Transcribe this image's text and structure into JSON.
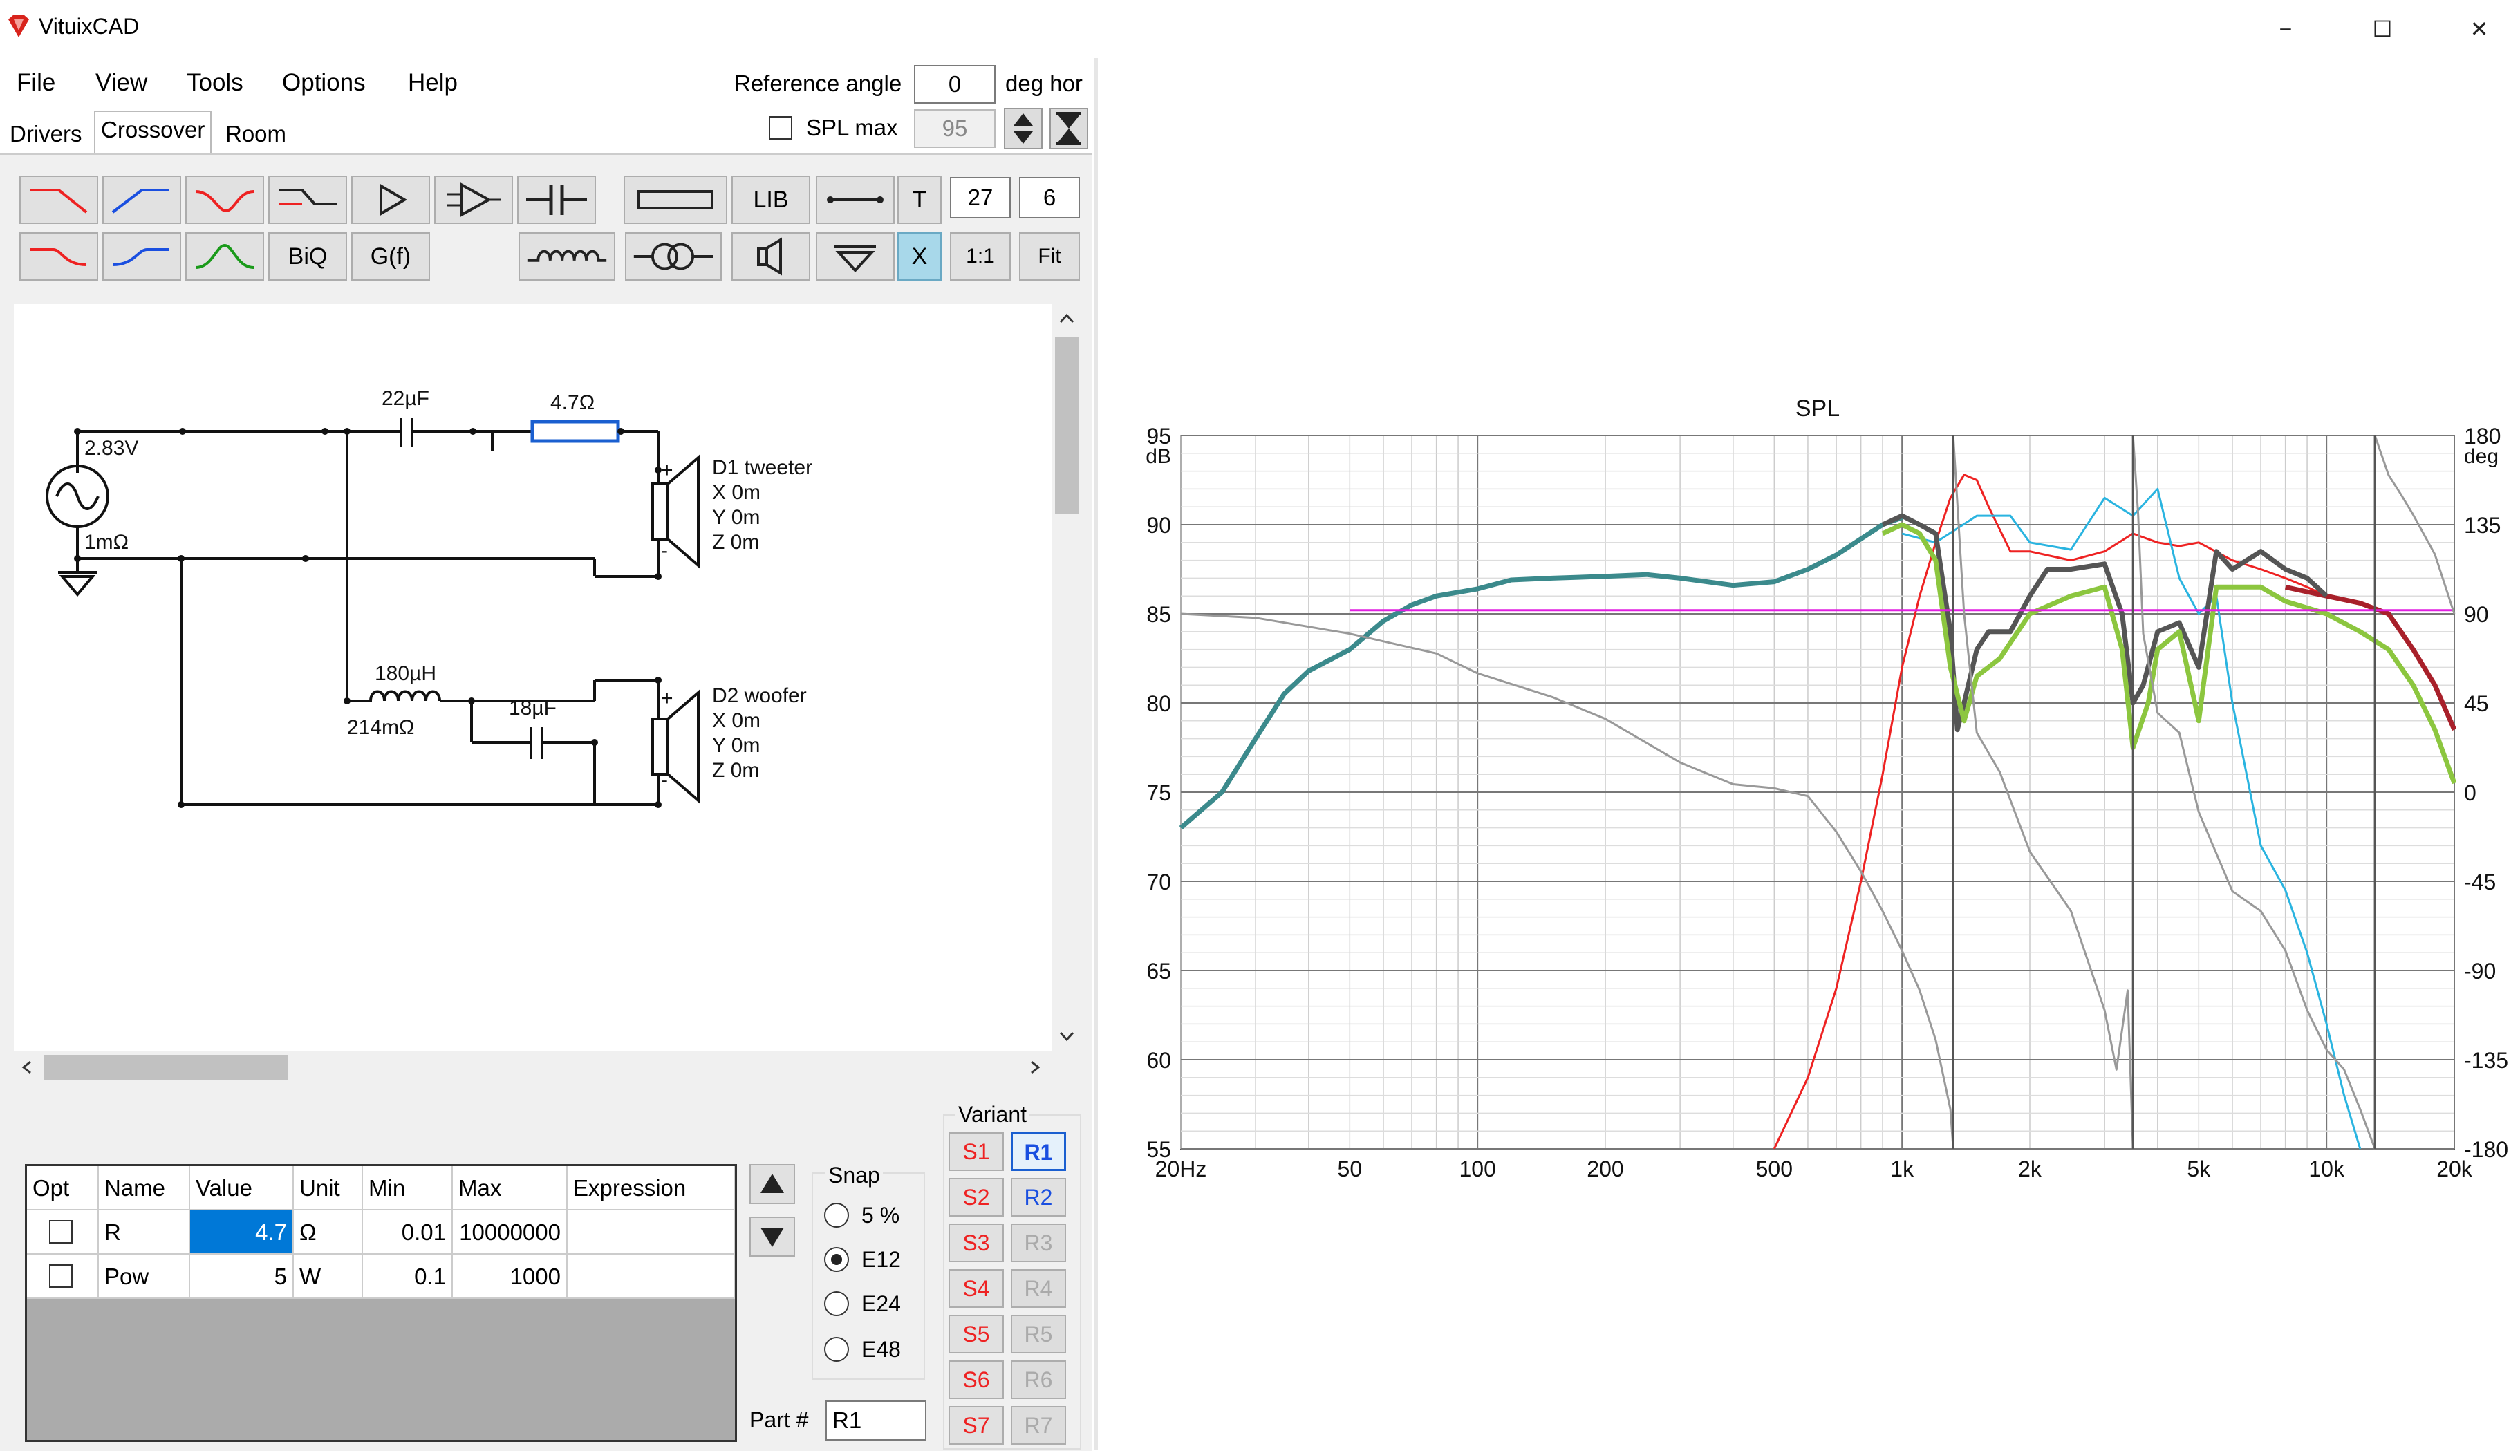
{
  "window": {
    "title": "VituixCAD",
    "minimize": "−",
    "maximize": "☐",
    "close": "✕"
  },
  "menu": [
    "File",
    "View",
    "Tools",
    "Options",
    "Help"
  ],
  "reference_angle": {
    "label": "Reference angle",
    "value": "0",
    "unit": "deg hor"
  },
  "spl_max": {
    "label": "SPL max",
    "value": "95",
    "checked": false
  },
  "tabs": [
    "Drivers",
    "Crossover",
    "Room"
  ],
  "active_tab": "Crossover",
  "toolbar": {
    "lib": "LIB",
    "t": "T",
    "t_value1": "27",
    "t_value2": "6",
    "x": "X",
    "one_to_one": "1:1",
    "fit": "Fit",
    "biq": "BiQ",
    "gf": "G(f)"
  },
  "schematic": {
    "source_voltage": "2.83V",
    "source_resistance": "1mΩ",
    "c1": "22µF",
    "r1": "4.7Ω",
    "l1": "180µH",
    "l1_resistance": "214mΩ",
    "c2": "18µF",
    "d1": {
      "name": "D1 tweeter",
      "x": "X 0m",
      "y": "Y 0m",
      "z": "Z 0m"
    },
    "d2": {
      "name": "D2 woofer",
      "x": "X 0m",
      "y": "Y 0m",
      "z": "Z 0m"
    },
    "plus": "+",
    "minus": "-"
  },
  "part_table": {
    "headers": [
      "Opt",
      "Name",
      "Value",
      "Unit",
      "Min",
      "Max",
      "Expression"
    ],
    "rows": [
      {
        "opt": false,
        "name": "R",
        "value": "4.7",
        "unit": "Ω",
        "min": "0.01",
        "max": "10000000",
        "expression": ""
      },
      {
        "opt": false,
        "name": "Pow",
        "value": "5",
        "unit": "W",
        "min": "0.1",
        "max": "1000",
        "expression": ""
      }
    ]
  },
  "snap": {
    "label": "Snap",
    "options": [
      "5 %",
      "E12",
      "E24",
      "E48"
    ],
    "selected": "E12"
  },
  "part_number": {
    "label": "Part #",
    "value": "R1"
  },
  "variant": {
    "label": "Variant",
    "s": [
      "S1",
      "S2",
      "S3",
      "S4",
      "S5",
      "S6",
      "S7"
    ],
    "r": [
      "R1",
      "R2",
      "R3",
      "R4",
      "R5",
      "R6",
      "R7"
    ],
    "active_r": "R1"
  },
  "colors": {
    "red": "#ee2222",
    "blue": "#1a4fe0",
    "green": "#1a9a1a",
    "sum_dark": "#555555",
    "sum_green": "#8cc63f",
    "cyan": "#2ab4e0",
    "teal": "#3b8a8c",
    "magenta": "#e020e0",
    "maroon": "#a8202a",
    "gray": "#999999"
  },
  "chart_data": {
    "type": "line",
    "title": "SPL",
    "x_scale": "log",
    "xlim": [
      20,
      20000
    ],
    "x_ticks": [
      "20Hz",
      "50",
      "100",
      "200",
      "500",
      "1k",
      "2k",
      "5k",
      "10k",
      "20k"
    ],
    "y_left_label": "dB",
    "ylim_left": [
      55,
      95
    ],
    "y_left_ticks": [
      "95",
      "90",
      "85",
      "80",
      "75",
      "70",
      "65",
      "60",
      "55"
    ],
    "y_right_label": "deg",
    "ylim_right": [
      -180,
      180
    ],
    "y_right_ticks": [
      "180",
      "135",
      "90",
      "45",
      "0",
      "-45",
      "-90",
      "-135",
      "-180"
    ],
    "grid": true,
    "series": [
      {
        "color": "#3b8a8c",
        "axis": "left",
        "points": [
          [
            20,
            73
          ],
          [
            25,
            75
          ],
          [
            30,
            78
          ],
          [
            35,
            80.5
          ],
          [
            40,
            81.8
          ],
          [
            50,
            83
          ],
          [
            60,
            84.6
          ],
          [
            70,
            85.5
          ],
          [
            80,
            86
          ],
          [
            100,
            86.4
          ],
          [
            120,
            86.9
          ],
          [
            150,
            87
          ],
          [
            200,
            87.1
          ],
          [
            250,
            87.2
          ],
          [
            300,
            87
          ],
          [
            400,
            86.6
          ],
          [
            500,
            86.8
          ],
          [
            600,
            87.5
          ],
          [
            700,
            88.3
          ],
          [
            800,
            89.2
          ],
          [
            900,
            90
          ],
          [
            1000,
            90.4
          ]
        ]
      },
      {
        "color": "#ee2222",
        "axis": "left",
        "points": [
          [
            500,
            55
          ],
          [
            600,
            59
          ],
          [
            700,
            64
          ],
          [
            800,
            70
          ],
          [
            900,
            76
          ],
          [
            1000,
            82
          ],
          [
            1100,
            86
          ],
          [
            1200,
            89
          ],
          [
            1300,
            91.5
          ],
          [
            1400,
            92.8
          ],
          [
            1500,
            92.5
          ],
          [
            1600,
            91
          ],
          [
            1800,
            88.5
          ],
          [
            2000,
            88.5
          ],
          [
            2500,
            88
          ],
          [
            3000,
            88.5
          ],
          [
            3500,
            89.5
          ],
          [
            4000,
            89
          ],
          [
            4500,
            88.8
          ],
          [
            5000,
            89
          ],
          [
            6000,
            88
          ],
          [
            7000,
            87.5
          ],
          [
            8000,
            87
          ],
          [
            9000,
            86.5
          ],
          [
            10000,
            86
          ]
        ]
      },
      {
        "color": "#a8202a",
        "axis": "left",
        "points": [
          [
            8000,
            86.5
          ],
          [
            10000,
            86
          ],
          [
            12000,
            85.6
          ],
          [
            14000,
            85
          ],
          [
            16000,
            83
          ],
          [
            18000,
            81
          ],
          [
            20000,
            78.5
          ]
        ]
      },
      {
        "color": "#2ab4e0",
        "axis": "left",
        "points": [
          [
            1000,
            89.5
          ],
          [
            1200,
            89
          ],
          [
            1500,
            90.5
          ],
          [
            1800,
            90.5
          ],
          [
            2000,
            89
          ],
          [
            2500,
            88.6
          ],
          [
            3000,
            91.5
          ],
          [
            3500,
            90.5
          ],
          [
            4000,
            92
          ],
          [
            4500,
            87
          ],
          [
            5000,
            85
          ],
          [
            5500,
            86
          ],
          [
            6000,
            80
          ],
          [
            7000,
            72
          ],
          [
            8000,
            69.5
          ],
          [
            9000,
            66
          ],
          [
            10000,
            62
          ],
          [
            11000,
            58
          ],
          [
            12000,
            55
          ]
        ]
      },
      {
        "color": "#555555",
        "axis": "left",
        "points": [
          [
            900,
            90
          ],
          [
            1000,
            90.5
          ],
          [
            1100,
            90
          ],
          [
            1200,
            89.5
          ],
          [
            1300,
            84
          ],
          [
            1350,
            78.5
          ],
          [
            1400,
            80
          ],
          [
            1500,
            83
          ],
          [
            1600,
            84
          ],
          [
            1800,
            84
          ],
          [
            2000,
            86
          ],
          [
            2200,
            87.5
          ],
          [
            2500,
            87.5
          ],
          [
            3000,
            87.8
          ],
          [
            3300,
            85
          ],
          [
            3500,
            80
          ],
          [
            3700,
            81
          ],
          [
            4000,
            84
          ],
          [
            4500,
            84.5
          ],
          [
            5000,
            82
          ],
          [
            5500,
            88.5
          ],
          [
            6000,
            87.5
          ],
          [
            7000,
            88.5
          ],
          [
            8000,
            87.5
          ],
          [
            9000,
            87
          ],
          [
            10000,
            86
          ]
        ]
      },
      {
        "color": "#8cc63f",
        "axis": "left",
        "points": [
          [
            900,
            89.5
          ],
          [
            1000,
            90
          ],
          [
            1100,
            89.5
          ],
          [
            1200,
            88
          ],
          [
            1300,
            82
          ],
          [
            1400,
            79
          ],
          [
            1500,
            81.5
          ],
          [
            1700,
            82.5
          ],
          [
            2000,
            85
          ],
          [
            2500,
            86
          ],
          [
            3000,
            86.5
          ],
          [
            3300,
            83
          ],
          [
            3500,
            77.5
          ],
          [
            3800,
            80
          ],
          [
            4000,
            83
          ],
          [
            4500,
            84
          ],
          [
            5000,
            79
          ],
          [
            5500,
            86.5
          ],
          [
            6000,
            86.5
          ],
          [
            7000,
            86.5
          ],
          [
            8000,
            85.7
          ],
          [
            10000,
            85
          ],
          [
            12000,
            84
          ],
          [
            14000,
            83
          ],
          [
            16000,
            81
          ],
          [
            18000,
            78.5
          ],
          [
            20000,
            75.5
          ]
        ]
      },
      {
        "color": "#e020e0",
        "axis": "left",
        "points": [
          [
            50,
            85.2
          ],
          [
            20000,
            85.2
          ]
        ]
      },
      {
        "color": "#999999",
        "axis": "right",
        "points": [
          [
            20,
            90
          ],
          [
            30,
            88
          ],
          [
            50,
            80
          ],
          [
            80,
            70
          ],
          [
            100,
            60
          ],
          [
            150,
            48
          ],
          [
            200,
            37
          ],
          [
            300,
            15
          ],
          [
            400,
            4
          ],
          [
            500,
            2
          ],
          [
            600,
            -2
          ],
          [
            700,
            -20
          ],
          [
            800,
            -40
          ],
          [
            900,
            -60
          ],
          [
            1000,
            -80
          ],
          [
            1100,
            -100
          ],
          [
            1200,
            -125
          ],
          [
            1300,
            -160
          ],
          [
            1320,
            -180
          ]
        ]
      },
      {
        "color": "#999999",
        "axis": "right",
        "points": [
          [
            1320,
            180
          ],
          [
            1400,
            90
          ],
          [
            1500,
            30
          ],
          [
            1700,
            10
          ],
          [
            2000,
            -30
          ],
          [
            2500,
            -60
          ],
          [
            3000,
            -110
          ],
          [
            3200,
            -140
          ],
          [
            3400,
            -100
          ],
          [
            3500,
            -180
          ]
        ]
      },
      {
        "color": "#999999",
        "axis": "right",
        "points": [
          [
            3500,
            180
          ],
          [
            3600,
            140
          ],
          [
            3700,
            80
          ],
          [
            4000,
            40
          ],
          [
            4500,
            30
          ],
          [
            5000,
            -10
          ],
          [
            6000,
            -50
          ],
          [
            7000,
            -60
          ],
          [
            8000,
            -80
          ],
          [
            9000,
            -110
          ],
          [
            10000,
            -130
          ],
          [
            11000,
            -140
          ],
          [
            12000,
            -160
          ],
          [
            13000,
            -180
          ]
        ]
      },
      {
        "color": "#999999",
        "axis": "right",
        "points": [
          [
            13000,
            180
          ],
          [
            14000,
            160
          ],
          [
            15000,
            150
          ],
          [
            16000,
            140
          ],
          [
            18000,
            120
          ],
          [
            20000,
            90
          ]
        ]
      },
      {
        "color": "#555555",
        "axis": "left",
        "points": [
          [
            1320,
            55
          ],
          [
            1320,
            95
          ]
        ]
      },
      {
        "color": "#555555",
        "axis": "left",
        "points": [
          [
            3500,
            55
          ],
          [
            3500,
            95
          ]
        ]
      },
      {
        "color": "#555555",
        "axis": "left",
        "points": [
          [
            13000,
            55
          ],
          [
            13000,
            95
          ]
        ]
      }
    ]
  }
}
